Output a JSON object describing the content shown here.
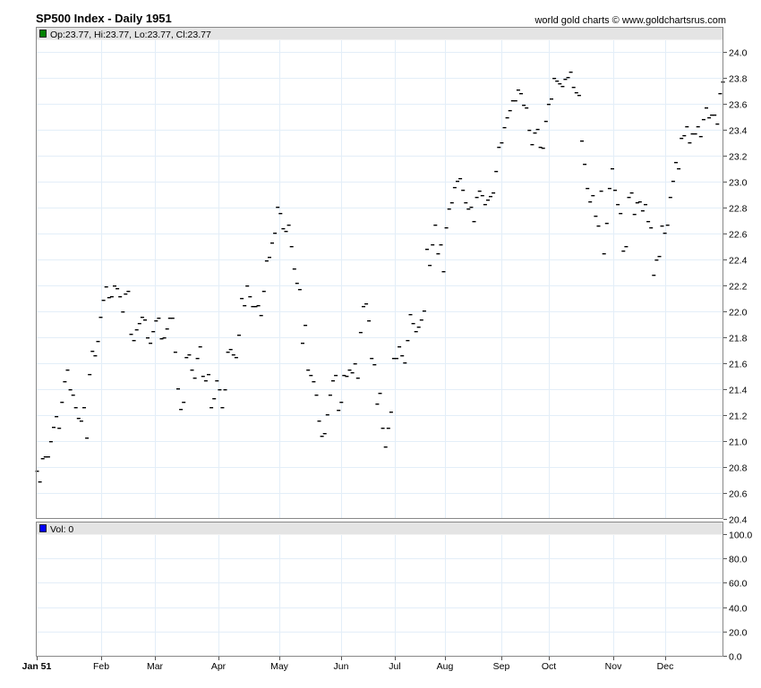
{
  "header": {
    "title": "SP500 Index - Daily 1951",
    "credit": "world gold charts © www.goldchartsrus.com"
  },
  "colors": {
    "price_legend": "#008000",
    "volume_legend": "#0000ff",
    "grid": "#e3eef8",
    "band": "#e4e4e4"
  },
  "chart_data": [
    {
      "type": "ohlc",
      "panel": "price",
      "legend": "Op:23.77, Hi:23.77, Lo:23.77, Cl:23.77",
      "ylim": [
        20.4,
        24.0
      ],
      "yticks": [
        "24.0",
        "23.8",
        "23.6",
        "23.4",
        "23.2",
        "23.0",
        "22.8",
        "22.6",
        "22.4",
        "22.2",
        "22.0",
        "21.8",
        "21.6",
        "21.4",
        "21.2",
        "21.0",
        "20.8",
        "20.6",
        "20.4"
      ],
      "xticks": [
        "Jan 51",
        "Feb",
        "Mar",
        "Apr",
        "May",
        "Jun",
        "Jul",
        "Aug",
        "Sep",
        "Oct",
        "Nov",
        "Dec"
      ],
      "grid": true,
      "months": [
        [
          20.77,
          20.69,
          20.87,
          20.88,
          20.88,
          21.0,
          21.11,
          21.19,
          21.1,
          21.3,
          21.46,
          21.55,
          21.4,
          21.36,
          21.26,
          21.18,
          21.16,
          21.26,
          21.03,
          21.52,
          21.7,
          21.66
        ],
        [
          21.77,
          21.96,
          22.09,
          22.19,
          22.11,
          22.12,
          22.2,
          22.18,
          22.12,
          22.0,
          22.14,
          22.16,
          21.83,
          21.78,
          21.86,
          21.91,
          21.96,
          21.94,
          21.8
        ],
        [
          21.76,
          21.85,
          21.93,
          21.95,
          21.79,
          21.8,
          21.87,
          21.95,
          21.95,
          21.69,
          21.41,
          21.25,
          21.3,
          21.65,
          21.67,
          21.55,
          21.49,
          21.64,
          21.73,
          21.5,
          21.47,
          21.52
        ],
        [
          21.26,
          21.33,
          21.47,
          21.4,
          21.26,
          21.4,
          21.69,
          21.71,
          21.67,
          21.65,
          21.82,
          22.1,
          22.05,
          22.2,
          22.12,
          22.04,
          22.04,
          22.05,
          21.97,
          22.16
        ],
        [
          22.39,
          22.42,
          22.53,
          22.61,
          22.81,
          22.76,
          22.64,
          22.62,
          22.67,
          22.5,
          22.33,
          22.22,
          22.17,
          21.76,
          21.9,
          21.55,
          21.51,
          21.46,
          21.36,
          21.16,
          21.04,
          21.06
        ],
        [
          21.21,
          21.36,
          21.47,
          21.51,
          21.24,
          21.3,
          21.51,
          21.5,
          21.55,
          21.53,
          21.6,
          21.49,
          21.84,
          22.04,
          22.06,
          21.93,
          21.64,
          21.59,
          21.29,
          21.37
        ],
        [
          21.1,
          20.96,
          21.1,
          21.23,
          21.64,
          21.64,
          21.73,
          21.66,
          21.61,
          21.78,
          21.98,
          21.91,
          21.85,
          21.88,
          21.94,
          22.01,
          22.48,
          22.36,
          22.52,
          22.67
        ],
        [
          22.45,
          22.52,
          22.31,
          22.65,
          22.79,
          22.84,
          22.96,
          23.01,
          23.03,
          22.94,
          22.84,
          22.79,
          22.81,
          22.7,
          22.88,
          22.93,
          22.9,
          22.83,
          22.86,
          22.89,
          22.92,
          23.08,
          23.27
        ],
        [
          23.3,
          23.42,
          23.5,
          23.55,
          23.63,
          23.63,
          23.71,
          23.68,
          23.59,
          23.57,
          23.4,
          23.29,
          23.38,
          23.41,
          23.27,
          23.26,
          23.47,
          23.6
        ],
        [
          23.64,
          23.8,
          23.78,
          23.76,
          23.74,
          23.79,
          23.81,
          23.85,
          23.73,
          23.69,
          23.67,
          23.32,
          23.14,
          22.95,
          22.85,
          22.9,
          22.74,
          22.66,
          22.93,
          22.45,
          22.68,
          22.95
        ],
        [
          23.1,
          22.94,
          22.83,
          22.76,
          22.47,
          22.5,
          22.88,
          22.92,
          22.75,
          22.84,
          22.85,
          22.78,
          22.83,
          22.7,
          22.65,
          22.28,
          22.4,
          22.43,
          22.66,
          22.61,
          22.67
        ],
        [
          22.88,
          23.01,
          23.15,
          23.1,
          23.34,
          23.36,
          23.43,
          23.3,
          23.37,
          23.37,
          23.43,
          23.35,
          23.48,
          23.57,
          23.5,
          23.52,
          23.52,
          23.45,
          23.68,
          23.77
        ]
      ]
    },
    {
      "type": "bar",
      "panel": "volume",
      "legend": "Vol: 0",
      "ylim": [
        0,
        100
      ],
      "yticks": [
        "100.0",
        "80.0",
        "60.0",
        "40.0",
        "20.0",
        "0.0"
      ],
      "values": "all 0"
    }
  ]
}
